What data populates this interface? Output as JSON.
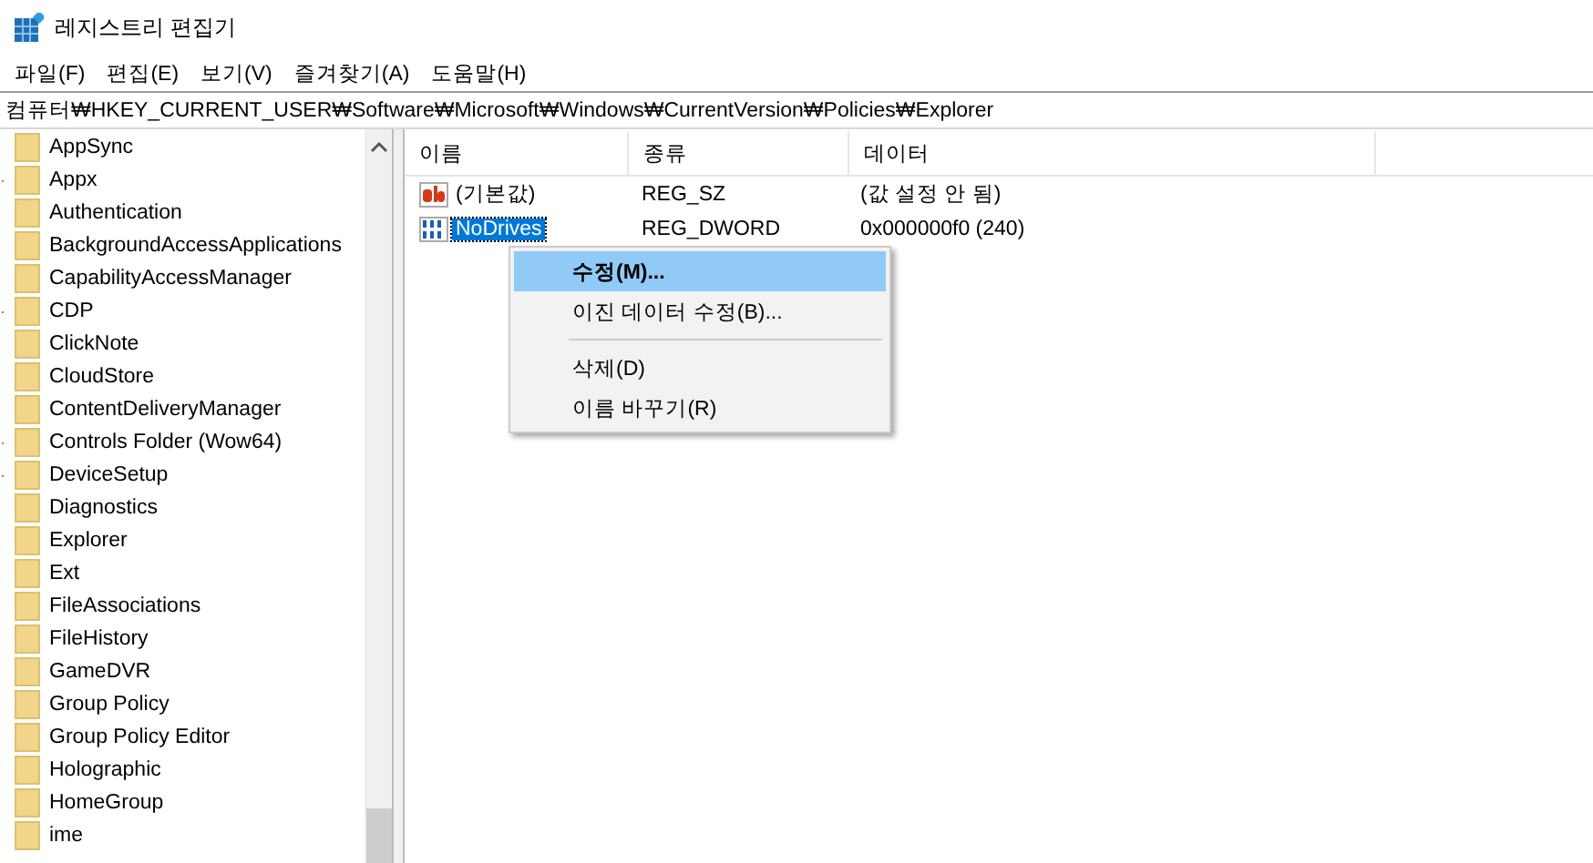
{
  "window": {
    "title": "레지스트리 편집기"
  },
  "menu_bar": [
    "파일(F)",
    "편집(E)",
    "보기(V)",
    "즐겨찾기(A)",
    "도움말(H)"
  ],
  "address_bar": "컴퓨터₩HKEY_CURRENT_USER₩Software₩Microsoft₩Windows₩CurrentVersion₩Policies₩Explorer",
  "tree": {
    "items": [
      {
        "label": "AppSync",
        "expandable": false
      },
      {
        "label": "Appx",
        "expandable": true
      },
      {
        "label": "Authentication",
        "expandable": false
      },
      {
        "label": "BackgroundAccessApplications",
        "expandable": false
      },
      {
        "label": "CapabilityAccessManager",
        "expandable": false
      },
      {
        "label": "CDP",
        "expandable": true
      },
      {
        "label": "ClickNote",
        "expandable": false
      },
      {
        "label": "CloudStore",
        "expandable": false
      },
      {
        "label": "ContentDeliveryManager",
        "expandable": false
      },
      {
        "label": "Controls Folder (Wow64)",
        "expandable": true
      },
      {
        "label": "DeviceSetup",
        "expandable": true
      },
      {
        "label": "Diagnostics",
        "expandable": false
      },
      {
        "label": "Explorer",
        "expandable": false
      },
      {
        "label": "Ext",
        "expandable": false
      },
      {
        "label": "FileAssociations",
        "expandable": false
      },
      {
        "label": "FileHistory",
        "expandable": false
      },
      {
        "label": "GameDVR",
        "expandable": false
      },
      {
        "label": "Group Policy",
        "expandable": false
      },
      {
        "label": "Group Policy Editor",
        "expandable": false
      },
      {
        "label": "Holographic",
        "expandable": false
      },
      {
        "label": "HomeGroup",
        "expandable": false
      },
      {
        "label": "ime",
        "expandable": false
      }
    ]
  },
  "table": {
    "columns": [
      "이름",
      "종류",
      "데이터"
    ],
    "rows": [
      {
        "kind": "string",
        "name": "(기본값)",
        "type": "REG_SZ",
        "data": "(값 설정 안 됨)",
        "selected": false
      },
      {
        "kind": "binary",
        "name": "NoDrives",
        "type": "REG_DWORD",
        "data": "0x000000f0 (240)",
        "selected": true
      }
    ]
  },
  "context_menu": {
    "items": [
      {
        "kind": "item",
        "label": "수정(M)...",
        "selected": true
      },
      {
        "kind": "item",
        "label": "이진 데이터 수정(B)...",
        "selected": false
      },
      {
        "kind": "separator"
      },
      {
        "kind": "item",
        "label": "삭제(D)",
        "selected": false
      },
      {
        "kind": "item",
        "label": "이름 바꾸기(R)",
        "selected": false
      }
    ]
  }
}
